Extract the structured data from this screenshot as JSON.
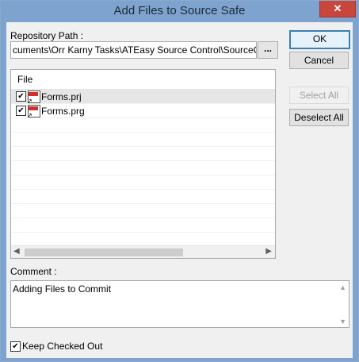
{
  "window": {
    "title": "Add Files to Source Safe",
    "close_glyph": "✕"
  },
  "repository": {
    "label": "Repository Path :",
    "value": "cuments\\Orr Karny Tasks\\ATEasy Source Control\\SourceControl",
    "browse_label": "..."
  },
  "buttons": {
    "ok": "OK",
    "cancel": "Cancel",
    "select_all": "Select All",
    "deselect_all": "Deselect All"
  },
  "file_list": {
    "header": "File",
    "items": [
      {
        "name": "Forms.prj",
        "checked": true,
        "icon": "prj-file-icon",
        "icon_tag": "PRJ"
      },
      {
        "name": "Forms.prg",
        "checked": true,
        "icon": "prg-file-icon",
        "icon_tag": "PRG"
      }
    ]
  },
  "comment": {
    "label": "Comment :",
    "value": "Adding Files to Commit"
  },
  "keep_checked_out": {
    "label": "Keep Checked Out",
    "checked": true
  },
  "colors": {
    "titlebar": "#7ea3cf",
    "close": "#c9463d",
    "default_border": "#3c7fb1"
  }
}
